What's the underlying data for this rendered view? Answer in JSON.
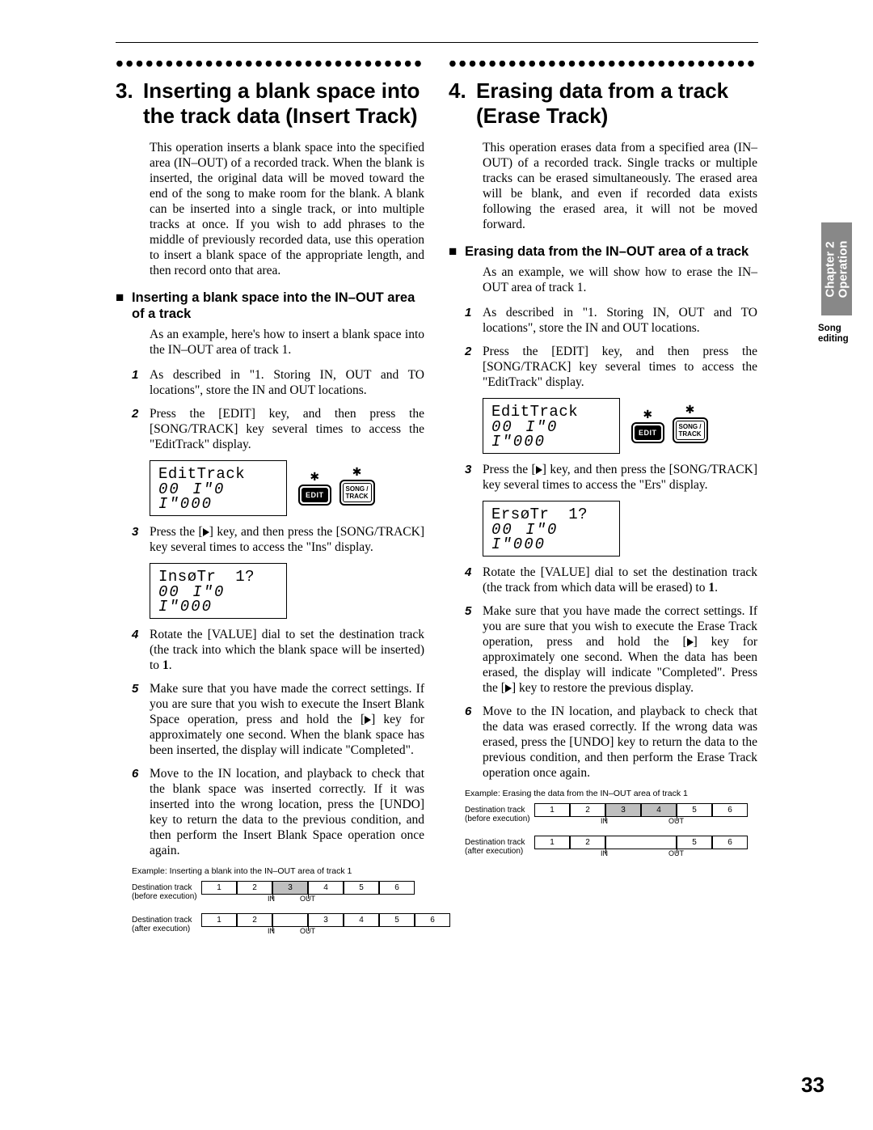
{
  "page_number": "33",
  "side_tab": {
    "line1": "Chapter 2",
    "line2": "Operation"
  },
  "side_label": "Song editing",
  "left": {
    "heading_num": "3.",
    "heading": "Inserting a blank space into the track data (Insert Track)",
    "intro": "This operation inserts a blank space into the specified area (IN–OUT) of a recorded track. When the blank is inserted, the original data will be moved toward the end of the song to make room for the blank. A blank can be inserted into a single track, or into multiple tracks at once. If you wish to add phrases to the middle of previously recorded data, use this operation to insert a blank space of the appropriate length, and then record onto that area.",
    "sub_title": "Inserting a blank space into the IN–OUT area of a track",
    "sub_intro": "As an example, here's how to insert a blank space into the IN–OUT area of track 1.",
    "steps": [
      "As described in \"1. Storing IN, OUT and TO locations\", store the IN and OUT locations.",
      "Press the [EDIT] key, and then press the [SONG/TRACK] key several times to access the \"EditTrack\" display.",
      "Press the [▶] key, and then press the [SONG/TRACK] key several times to access the \"Ins\" display.",
      "Rotate the [VALUE] dial to set the destination track (the track into which the blank space will be inserted) to 1.",
      "Make sure that you have made the correct settings. If you are sure that you wish to execute the Insert Blank Space operation, press and hold the [▶] key for approximately one second. When the blank space has been inserted, the display will indicate \"Completed\".",
      "Move to the IN location, and playback to check that the blank space was inserted correctly. If it was inserted into the wrong location, press the [UNDO] key to return the data to the previous condition, and then perform the Insert Blank Space operation once again."
    ],
    "lcd1": {
      "line1": "EditTrack",
      "line2": "00 I\"0 I\"000"
    },
    "lcd2": {
      "line1": "InsøTr  1?",
      "line2": "00 I\"0 I\"000"
    },
    "btn_edit": "EDIT",
    "btn_song": "SONG /\nTRACK",
    "example_caption": "Example:  Inserting a blank into the IN–OUT area of track 1",
    "diagram": {
      "before_label": "Destination track\n(before execution)",
      "after_label": "Destination track\n(after execution)",
      "cells": [
        "1",
        "2",
        "3",
        "4",
        "5",
        "6"
      ],
      "marker_in": "IN",
      "marker_out": "OUT"
    }
  },
  "right": {
    "heading_num": "4.",
    "heading": "Erasing data from a track (Erase Track)",
    "intro": "This operation erases data from a specified area (IN–OUT) of a recorded track. Single tracks or multiple tracks can be erased simultaneously. The erased area will be blank, and even if recorded data exists following the erased area, it will not be moved forward.",
    "sub_title": "Erasing data from the IN–OUT area of a track",
    "sub_intro": "As an example, we will show how to erase the IN–OUT area of track 1.",
    "steps": [
      "As described in \"1. Storing IN, OUT and TO locations\", store the IN and OUT locations.",
      "Press the [EDIT] key, and then press the [SONG/TRACK] key several times to access the \"EditTrack\" display.",
      "Press the [▶] key, and then press the [SONG/TRACK] key several times to access the \"Ers\" display.",
      "Rotate the [VALUE] dial to set the destination track (the track from which data will be erased) to 1.",
      "Make sure that you have made the correct settings. If you are sure that you wish to execute the Erase Track operation, press and hold the [▶] key for approximately one second. When the data has been erased, the display will indicate \"Completed\". Press the [▶] key to restore the previous display.",
      "Move to the IN location, and playback to check that the data was erased correctly. If the wrong data was erased, press the [UNDO] key to return the data to the previous condition, and then perform the Erase Track operation once again."
    ],
    "lcd1": {
      "line1": "EditTrack",
      "line2": "00 I\"0 I\"000"
    },
    "lcd2": {
      "line1": "ErsøTr  1?",
      "line2": "00 I\"0 I\"000"
    },
    "btn_edit": "EDIT",
    "btn_song": "SONG /\nTRACK",
    "example_caption": "Example:  Erasing the data from the IN–OUT area of track 1",
    "diagram": {
      "before_label": "Destination track\n(before execution)",
      "after_label": "Destination track\n(after execution)",
      "cells": [
        "1",
        "2",
        "3",
        "4",
        "5",
        "6"
      ],
      "marker_in": "IN",
      "marker_out": "OUT"
    }
  }
}
